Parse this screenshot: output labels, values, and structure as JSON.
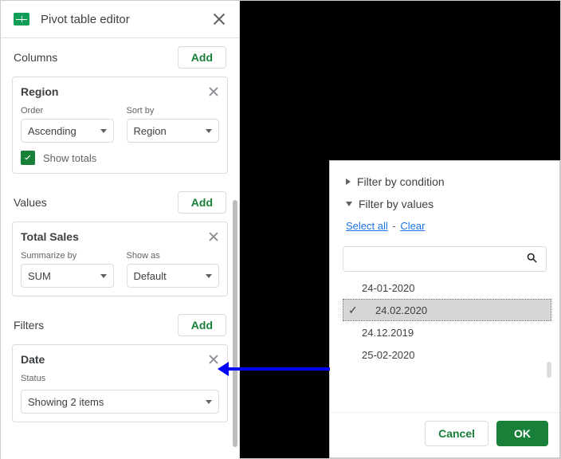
{
  "header": {
    "title": "Pivot table editor"
  },
  "sections": {
    "columns": {
      "label": "Columns",
      "add": "Add"
    },
    "values": {
      "label": "Values",
      "add": "Add"
    },
    "filters": {
      "label": "Filters",
      "add": "Add"
    }
  },
  "columnsCard": {
    "title": "Region",
    "orderLabel": "Order",
    "orderValue": "Ascending",
    "sortByLabel": "Sort by",
    "sortByValue": "Region",
    "showTotalsLabel": "Show totals",
    "showTotalsChecked": true
  },
  "valuesCard": {
    "title": "Total Sales",
    "summarizeLabel": "Summarize by",
    "summarizeValue": "SUM",
    "showAsLabel": "Show as",
    "showAsValue": "Default"
  },
  "filtersCard": {
    "title": "Date",
    "statusLabel": "Status",
    "statusValue": "Showing 2 items"
  },
  "filterPopup": {
    "byCondition": "Filter by condition",
    "byValues": "Filter by values",
    "selectAll": "Select all",
    "clear": "Clear",
    "items": [
      {
        "label": "24-01-2020",
        "selected": false
      },
      {
        "label": "24.02.2020",
        "selected": true
      },
      {
        "label": "24.12.2019",
        "selected": false
      },
      {
        "label": "25-02-2020",
        "selected": false
      }
    ],
    "cancel": "Cancel",
    "ok": "OK"
  }
}
